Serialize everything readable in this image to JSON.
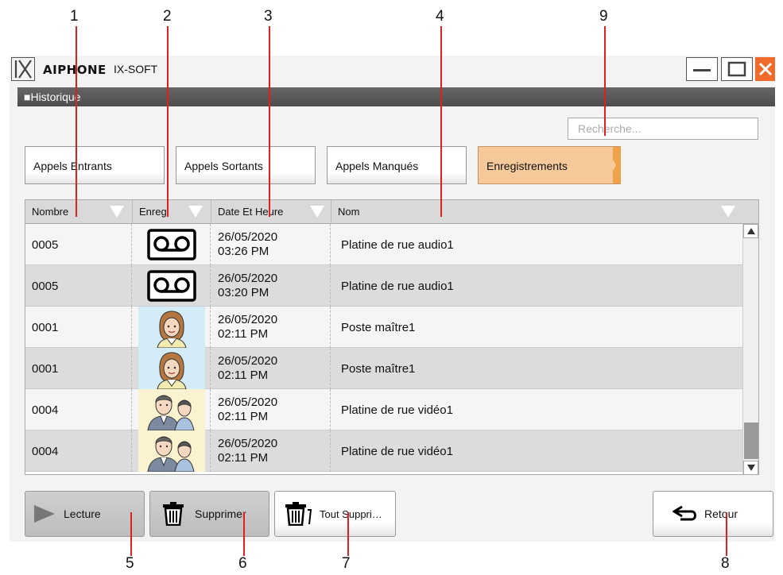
{
  "callouts": [
    "1",
    "2",
    "3",
    "4",
    "5",
    "6",
    "7",
    "8",
    "9"
  ],
  "window": {
    "logo_text": "IX",
    "brand": "AIPHONE",
    "product": "IX-SOFT",
    "controls": [
      "minimize-icon",
      "maximize-icon",
      "close-icon"
    ],
    "close_color": "#f06a2a"
  },
  "section": {
    "title": "■Historique"
  },
  "search": {
    "placeholder": "Recherche..."
  },
  "tabs": [
    {
      "label": "Appels Entrants",
      "active": false
    },
    {
      "label": "Appels Sortants",
      "active": false
    },
    {
      "label": "Appels Manqués",
      "active": false
    },
    {
      "label": "Enregistrements",
      "active": true
    }
  ],
  "accent_color": "#f6c99a",
  "table": {
    "columns": [
      "Nombre",
      "Enreg",
      "Date Et Heure",
      "Nom"
    ],
    "rows": [
      {
        "number": "0005",
        "record": "audio-tape-icon",
        "date": "26/05/2020",
        "time": "03:26 PM",
        "name": "Platine de rue audio1"
      },
      {
        "number": "0005",
        "record": "audio-tape-icon",
        "date": "26/05/2020",
        "time": "03:20 PM",
        "name": "Platine de rue audio1"
      },
      {
        "number": "0001",
        "record": "woman-thumbnail",
        "date": "26/05/2020",
        "time": "02:11 PM",
        "name": "Poste maître1"
      },
      {
        "number": "0001",
        "record": "woman-thumbnail",
        "date": "26/05/2020",
        "time": "02:11 PM",
        "name": "Poste maître1"
      },
      {
        "number": "0004",
        "record": "couple-thumbnail",
        "date": "26/05/2020",
        "time": "02:11 PM",
        "name": "Platine de rue vidéo1"
      },
      {
        "number": "0004",
        "record": "couple-thumbnail",
        "date": "26/05/2020",
        "time": "02:11 PM",
        "name": "Platine de rue vidéo1"
      }
    ]
  },
  "buttons": {
    "play": "Lecture",
    "delete": "Supprimer",
    "delete_all": "Tout Suppri…",
    "back": "Retour"
  }
}
